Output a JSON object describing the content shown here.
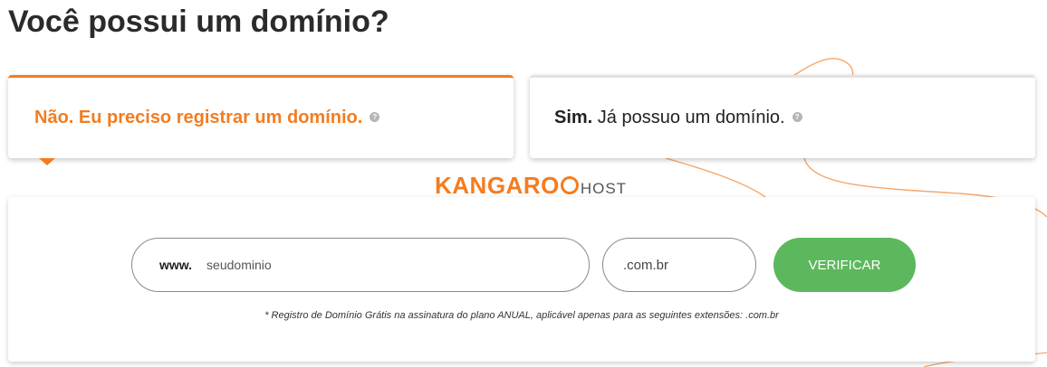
{
  "page_title": "Você possui um domínio?",
  "accent_color": "#f47c1f",
  "button_color": "#5cb85c",
  "tabs": {
    "no": {
      "label": "Não. Eu preciso registrar um domínio.",
      "active": true,
      "help_icon": "question-circle-icon"
    },
    "yes": {
      "strong": "Sim.",
      "label": " Já possuo um domínio.",
      "active": false,
      "help_icon": "question-circle-icon"
    }
  },
  "logo": {
    "main": "KANGARO",
    "sub": "HOST"
  },
  "search": {
    "prefix": "www.",
    "placeholder": "seudominio",
    "extension": ".com.br",
    "button_label": "VERIFICAR"
  },
  "note": "* Registro de Domínio Grátis na assinatura do plano ANUAL, aplicável apenas para as seguintes extensões: .com.br"
}
